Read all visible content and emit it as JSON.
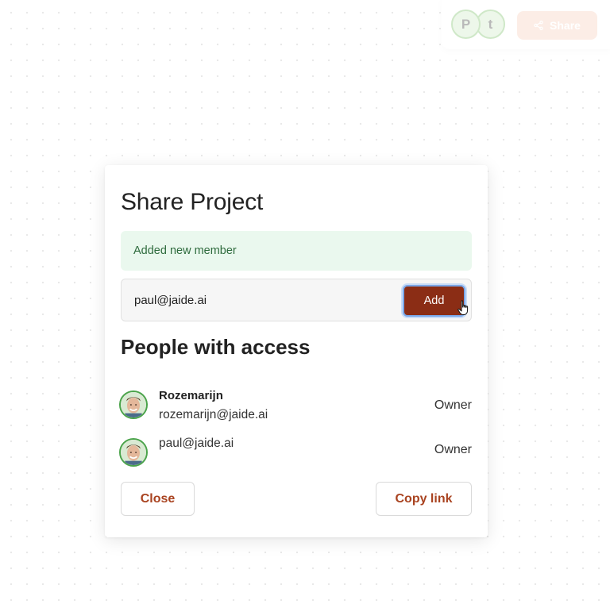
{
  "toolbar": {
    "avatars": [
      {
        "initial": "P"
      },
      {
        "initial": "t"
      }
    ],
    "share_label": "Share",
    "share_icon": "share-icon"
  },
  "modal": {
    "title": "Share Project",
    "success_message": "Added new member",
    "invite": {
      "email_value": "paul@jaide.ai",
      "add_label": "Add"
    },
    "section_title": "People with access",
    "people": [
      {
        "name": "Rozemarijn",
        "email": "rozemarijn@jaide.ai",
        "role": "Owner"
      },
      {
        "name": "",
        "email": "paul@jaide.ai",
        "role": "Owner"
      }
    ],
    "close_label": "Close",
    "copy_link_label": "Copy link"
  },
  "colors": {
    "accent": "#8b2d15",
    "accent_text": "#a94320",
    "success_bg": "#eaf8ee",
    "success_text": "#2e6b3d",
    "share_button_faded": "#fadfd2"
  }
}
